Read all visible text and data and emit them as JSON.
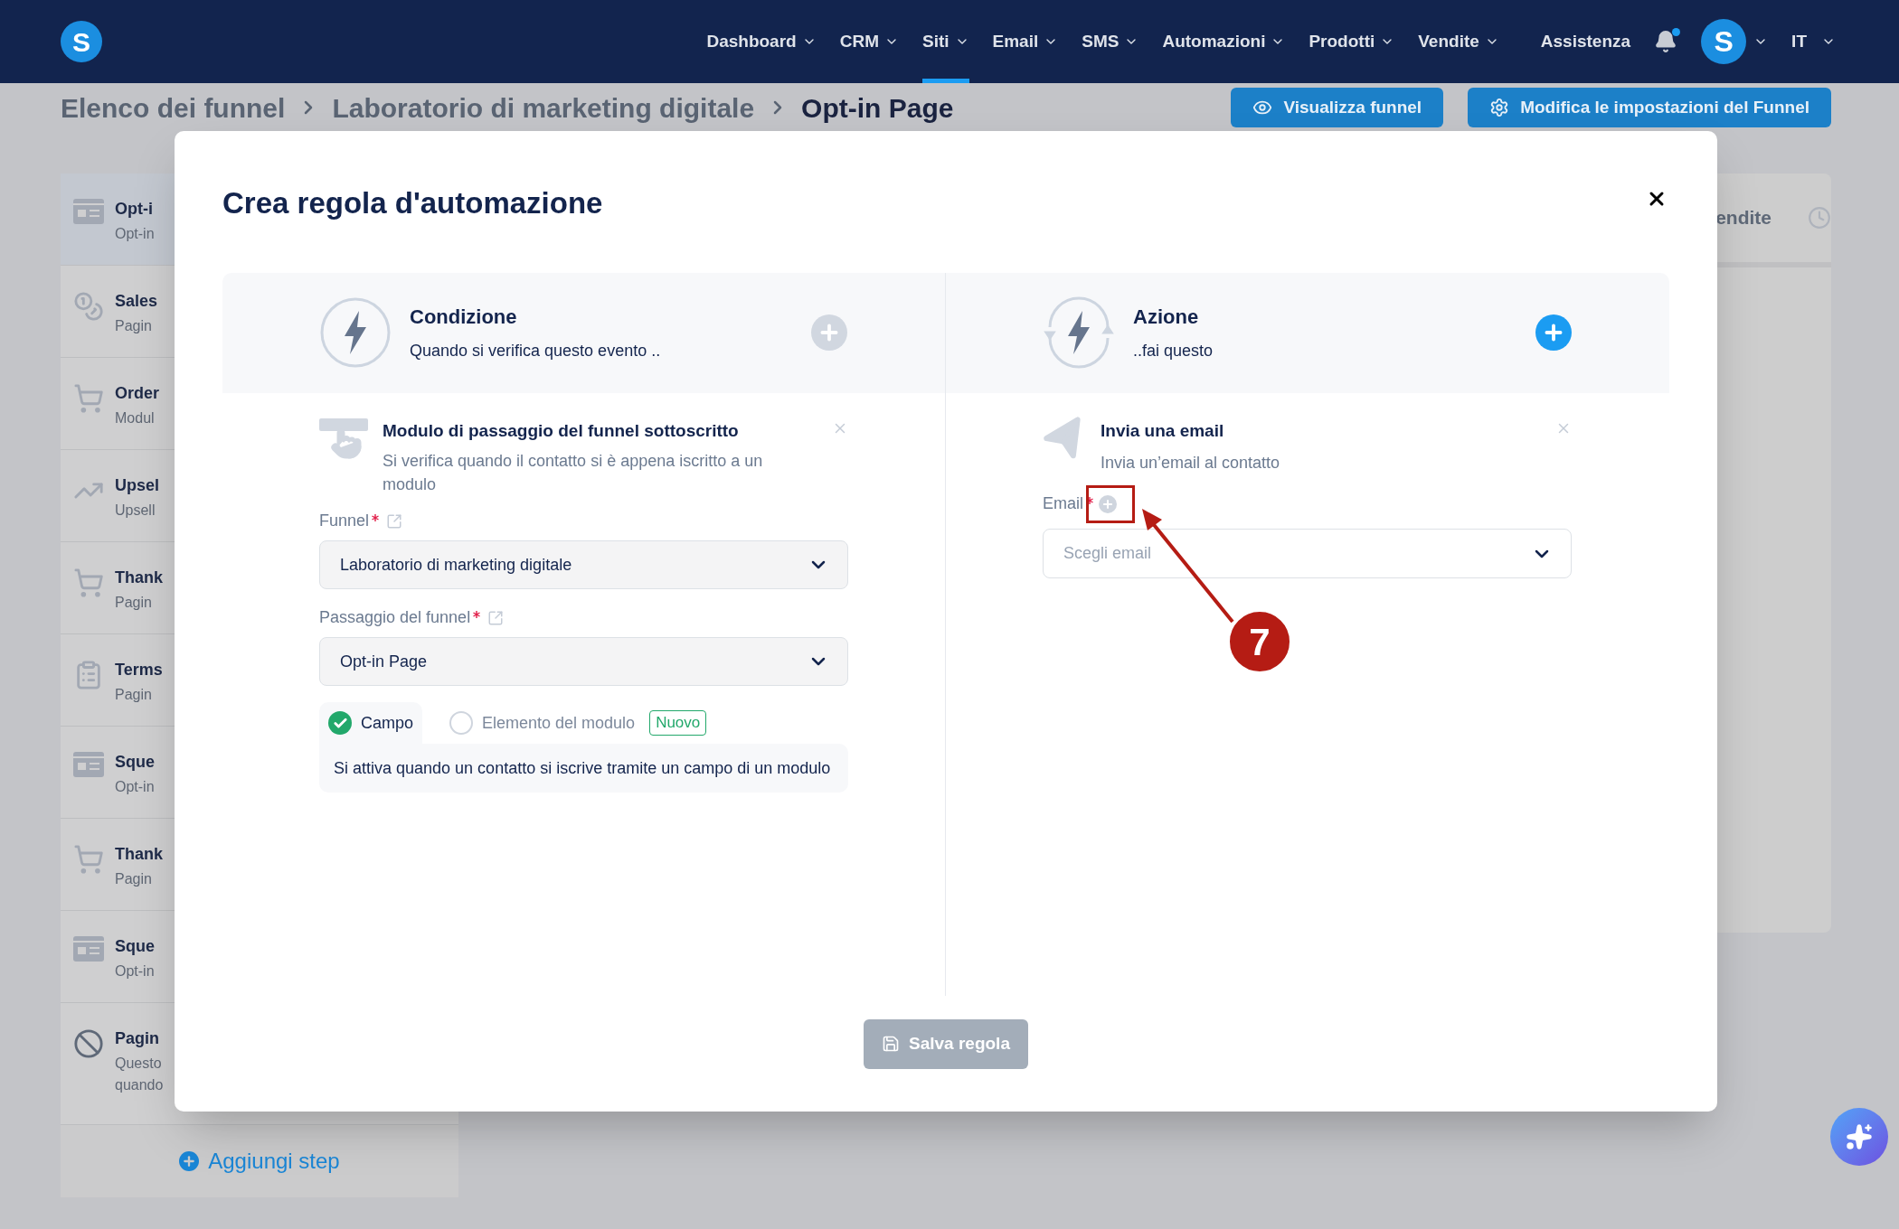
{
  "nav": {
    "logo": "S",
    "items": [
      {
        "label": "Dashboard",
        "selected": false
      },
      {
        "label": "CRM",
        "selected": false
      },
      {
        "label": "Siti",
        "selected": true
      },
      {
        "label": "Email",
        "selected": false
      },
      {
        "label": "SMS",
        "selected": false
      },
      {
        "label": "Automazioni",
        "selected": false
      },
      {
        "label": "Prodotti",
        "selected": false
      },
      {
        "label": "Vendite",
        "selected": false
      }
    ],
    "help": "Assistenza",
    "unread_notifications": true,
    "avatar": "S",
    "language": "IT"
  },
  "breadcrumb": [
    "Elenco dei funnel",
    "Laboratorio di marketing digitale",
    "Opt-in Page"
  ],
  "header_buttons": [
    {
      "label": "Visualizza funnel",
      "kind": "view"
    },
    {
      "label": "Modifica le impostazioni del Funnel",
      "kind": "settings"
    }
  ],
  "steps": [
    {
      "title": "Opt-i",
      "subtitle": "Opt-in",
      "kind": "optin",
      "selected": true
    },
    {
      "title": "Sales",
      "subtitle": "Pagin",
      "kind": "sales",
      "selected": false
    },
    {
      "title": "Order",
      "subtitle": "Modul",
      "kind": "order",
      "selected": false
    },
    {
      "title": "Upsel",
      "subtitle": "Upsell",
      "kind": "upsell",
      "selected": false
    },
    {
      "title": "Thank",
      "subtitle": "Pagin",
      "kind": "thanks",
      "selected": false
    },
    {
      "title": "Terms",
      "subtitle": "Pagin",
      "kind": "terms",
      "selected": false
    },
    {
      "title": "Sque",
      "subtitle": "Opt-in",
      "kind": "optin",
      "selected": false
    },
    {
      "title": "Thank",
      "subtitle": "Pagin",
      "kind": "thanks",
      "selected": false
    },
    {
      "title": "Sque",
      "subtitle": "Opt-in",
      "kind": "optin",
      "selected": false
    },
    {
      "title": "Pagin",
      "subtitle": "Questo quando",
      "kind": "blocked",
      "selected": false
    }
  ],
  "add_step": "Aggiungi step",
  "side_panel": {
    "tab": "endite"
  },
  "modal": {
    "title": "Crea regola d'automazione",
    "condition": {
      "title": "Condizione",
      "subtitle": "Quando si verifica questo evento ..",
      "add_active": false,
      "step": {
        "title": "Modulo di passaggio del funnel sottoscritto",
        "description": "Si verifica quando il contatto si è appena iscritto a un modulo"
      },
      "fields": [
        {
          "label": "Funnel",
          "required": true,
          "value": "Laboratorio di marketing digitale"
        },
        {
          "label": "Passaggio del funnel",
          "required": true,
          "value": "Opt-in Page"
        }
      ],
      "options": [
        {
          "label": "Campo",
          "selected": true
        },
        {
          "label": "Elemento del modulo",
          "selected": false,
          "badge": "Nuovo"
        }
      ],
      "option_description": "Si attiva quando un contatto si iscrive tramite un campo di un modulo"
    },
    "action": {
      "title": "Azione",
      "subtitle": "..fai questo",
      "add_active": true,
      "step": {
        "title": "Invia una email",
        "description": "Invia un’email al contatto"
      },
      "field": {
        "label": "Email",
        "required": true,
        "placeholder": "Scegli email"
      }
    },
    "save": {
      "label": "Salva regola",
      "disabled": true
    }
  },
  "annotation": {
    "number": "7"
  }
}
